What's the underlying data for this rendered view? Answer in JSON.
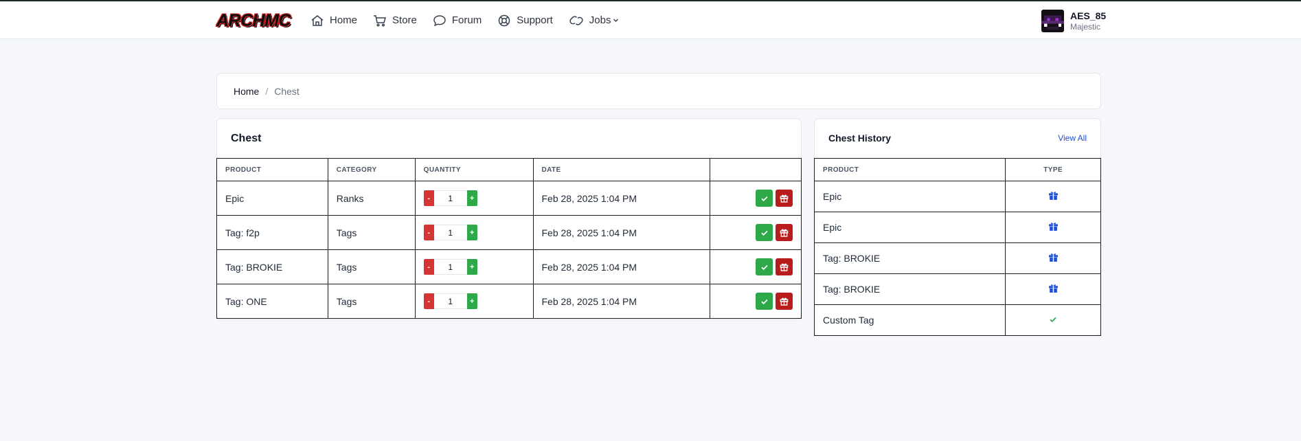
{
  "header": {
    "logo": "ARCHMC",
    "nav": [
      {
        "label": "Home",
        "icon": "home-icon"
      },
      {
        "label": "Store",
        "icon": "cart-icon"
      },
      {
        "label": "Forum",
        "icon": "chat-icon"
      },
      {
        "label": "Support",
        "icon": "lifebuoy-icon"
      },
      {
        "label": "Jobs",
        "icon": "link-icon"
      }
    ],
    "user": {
      "name": "AES_85",
      "rank": "Majestic"
    }
  },
  "breadcrumb": {
    "home": "Home",
    "separator": "/",
    "current": "Chest"
  },
  "chest": {
    "title": "Chest",
    "columns": [
      "PRODUCT",
      "CATEGORY",
      "QUANTITY",
      "DATE",
      ""
    ],
    "rows": [
      {
        "product": "Epic",
        "category": "Ranks",
        "quantity": "1",
        "date": "Feb 28, 2025 1:04 PM"
      },
      {
        "product": "Tag: f2p",
        "category": "Tags",
        "quantity": "1",
        "date": "Feb 28, 2025 1:04 PM"
      },
      {
        "product": "Tag: BROKIE",
        "category": "Tags",
        "quantity": "1",
        "date": "Feb 28, 2025 1:04 PM"
      },
      {
        "product": "Tag: ONE",
        "category": "Tags",
        "quantity": "1",
        "date": "Feb 28, 2025 1:04 PM"
      }
    ],
    "minus": "-",
    "plus": "+"
  },
  "history": {
    "title": "Chest History",
    "view_all": "View All",
    "columns": [
      "PRODUCT",
      "TYPE"
    ],
    "rows": [
      {
        "product": "Epic",
        "type": "gift"
      },
      {
        "product": "Epic",
        "type": "gift"
      },
      {
        "product": "Tag: BROKIE",
        "type": "gift"
      },
      {
        "product": "Tag: BROKIE",
        "type": "gift"
      },
      {
        "product": "Custom Tag",
        "type": "check"
      }
    ]
  },
  "colors": {
    "accent_blue": "#1d4ed8",
    "green": "#2fa84a",
    "red": "#b91c1c"
  }
}
